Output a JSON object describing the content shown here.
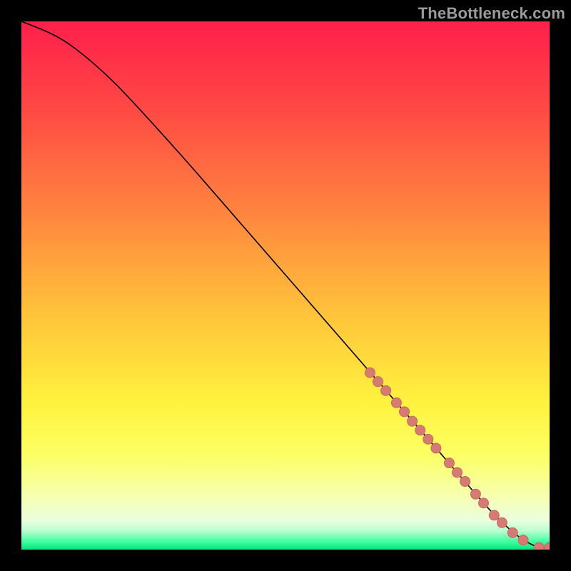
{
  "watermark": "TheBottleneck.com",
  "colors": {
    "gradient_stops": [
      {
        "offset": 0.0,
        "color": "#ff1f4b"
      },
      {
        "offset": 0.17,
        "color": "#ff4a44"
      },
      {
        "offset": 0.35,
        "color": "#ff813f"
      },
      {
        "offset": 0.55,
        "color": "#ffc23a"
      },
      {
        "offset": 0.72,
        "color": "#fff23e"
      },
      {
        "offset": 0.82,
        "color": "#fcff63"
      },
      {
        "offset": 0.9,
        "color": "#f6ffb1"
      },
      {
        "offset": 0.945,
        "color": "#eaffde"
      },
      {
        "offset": 0.965,
        "color": "#b7ffcf"
      },
      {
        "offset": 0.985,
        "color": "#3dffa0"
      },
      {
        "offset": 1.0,
        "color": "#06e37e"
      }
    ],
    "curve": "#000000",
    "point_fill": "#d77a73",
    "point_stroke": "#c36a62"
  },
  "chart_data": {
    "type": "line",
    "title": "",
    "xlabel": "",
    "ylabel": "",
    "xlim": [
      0,
      100
    ],
    "ylim": [
      0,
      100
    ],
    "grid": false,
    "series": [
      {
        "name": "curve",
        "x": [
          0,
          4,
          8,
          12,
          16,
          20,
          30,
          40,
          50,
          60,
          70,
          80,
          86,
          90,
          94,
          96,
          98,
          100
        ],
        "y": [
          100,
          98.5,
          96.5,
          93.5,
          90,
          86,
          75,
          63.5,
          52,
          40.5,
          29,
          17.5,
          10.5,
          6,
          2.5,
          1.2,
          0.4,
          0.4
        ]
      }
    ],
    "points": [
      {
        "x": 66,
        "y": 33.5
      },
      {
        "x": 67.5,
        "y": 31.8
      },
      {
        "x": 69,
        "y": 30.1
      },
      {
        "x": 71,
        "y": 27.8
      },
      {
        "x": 72.5,
        "y": 26.1
      },
      {
        "x": 74,
        "y": 24.3
      },
      {
        "x": 75.5,
        "y": 22.6
      },
      {
        "x": 77,
        "y": 20.9
      },
      {
        "x": 78.5,
        "y": 19.2
      },
      {
        "x": 81,
        "y": 16.4
      },
      {
        "x": 82.5,
        "y": 14.6
      },
      {
        "x": 84,
        "y": 12.9
      },
      {
        "x": 86,
        "y": 10.5
      },
      {
        "x": 87.5,
        "y": 8.8
      },
      {
        "x": 89.5,
        "y": 6.5
      },
      {
        "x": 91,
        "y": 5.1
      },
      {
        "x": 93,
        "y": 3.2
      },
      {
        "x": 95,
        "y": 1.8
      },
      {
        "x": 98,
        "y": 0.4
      },
      {
        "x": 100,
        "y": 0.4
      }
    ],
    "annotations": []
  }
}
